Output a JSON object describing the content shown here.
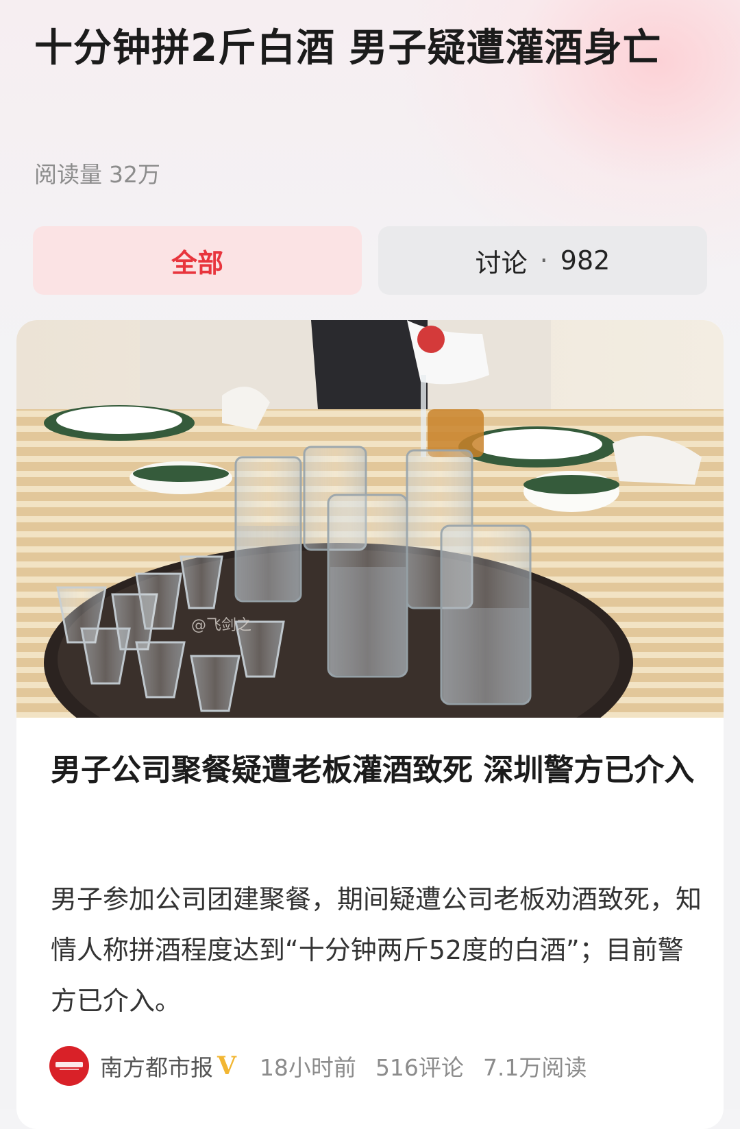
{
  "header": {
    "title": "十分钟拼2斤白酒 男子疑遭灌酒身亡",
    "read_label": "阅读量",
    "read_value": "32万"
  },
  "tabs": {
    "all_label": "全部",
    "discuss_label": "讨论",
    "discuss_separator": "·",
    "discuss_count": "982"
  },
  "article": {
    "watermark": "@飞剑之",
    "title": "男子公司聚餐疑遭老板灌酒致死 深圳警方已介入",
    "summary": "男子参加公司团建聚餐，期间疑遭公司老板劝酒致死，知情人称拼酒程度达到“十分钟两斤52度的白酒”；目前警方已介入。",
    "source": "南方都市报",
    "verified_badge": "V",
    "time": "18小时前",
    "comments": "516评论",
    "reads": "7.1万阅读"
  },
  "colors": {
    "accent_red": "#e8353d",
    "tab_active_bg": "#fbe3e4",
    "tab_inactive_bg": "#eaeaec",
    "avatar_red": "#d92128",
    "verified_gold": "#f2b632"
  },
  "icons": {
    "source_avatar": "newspaper-logo-icon",
    "verified": "verified-v-icon"
  }
}
